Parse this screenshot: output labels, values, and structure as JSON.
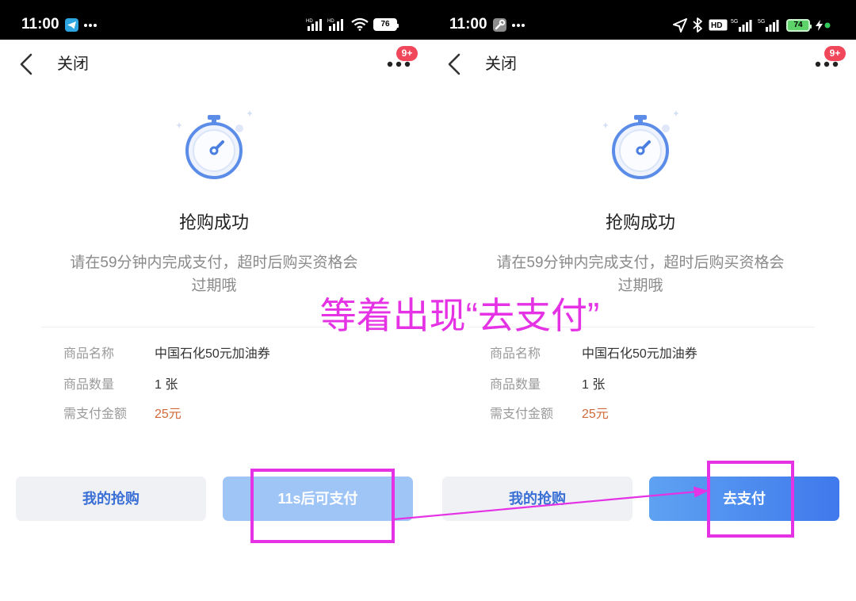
{
  "colors": {
    "accent": "#3a6fd6",
    "pay_disabled": "#9fc5f7",
    "pay_active": "#3f79ec",
    "price": "#d06a3a",
    "badge": "#f0485a",
    "annotation": "#e432e4",
    "battery_green": "#34c759",
    "icon_blue": "#5b8de8"
  },
  "phones": [
    {
      "status": {
        "time": "11:00",
        "app_icon": "telegram-icon",
        "more_icon": "more-dots-icon",
        "signal_labels": [
          "HD",
          "HD"
        ],
        "wifi_icon": "wifi-icon",
        "battery": "76"
      },
      "nav": {
        "back_icon": "chevron-left-icon",
        "close": "关闭",
        "menu_icon": "more-dots-icon",
        "badge": "9+"
      },
      "result": {
        "icon": "stopwatch-icon",
        "title": "抢购成功",
        "desc_line1": "请在59分钟内完成支付，超时后购买资格会",
        "desc_line2": "过期哦"
      },
      "details": [
        {
          "label": "商品名称",
          "value": "中国石化50元加油券"
        },
        {
          "label": "商品数量",
          "value": "1 张"
        },
        {
          "label": "需支付金额",
          "value": "25元"
        }
      ],
      "buttons": {
        "my_orders": "我的抢购",
        "pay": "11s后可支付",
        "pay_enabled": false
      }
    },
    {
      "status": {
        "time": "11:00",
        "app_icon": "wrench-icon",
        "more_icon": "more-dots-icon",
        "location_icon": "location-arrow-icon",
        "bluetooth_icon": "bluetooth-icon",
        "hd_label": "HD",
        "signal_labels": [
          "5G",
          "5G"
        ],
        "battery": "74",
        "charging_icon": "bolt-icon"
      },
      "nav": {
        "back_icon": "chevron-left-icon",
        "close": "关闭",
        "menu_icon": "more-dots-icon",
        "badge": "9+"
      },
      "result": {
        "icon": "stopwatch-icon",
        "title": "抢购成功",
        "desc_line1": "请在59分钟内完成支付，超时后购买资格会",
        "desc_line2": "过期哦"
      },
      "details": [
        {
          "label": "商品名称",
          "value": "中国石化50元加油券"
        },
        {
          "label": "商品数量",
          "value": "1 张"
        },
        {
          "label": "需支付金额",
          "value": "25元"
        }
      ],
      "buttons": {
        "my_orders": "我的抢购",
        "pay": "去支付",
        "pay_enabled": true
      }
    }
  ],
  "annotation": {
    "caption": "等着出现“去支付”"
  }
}
